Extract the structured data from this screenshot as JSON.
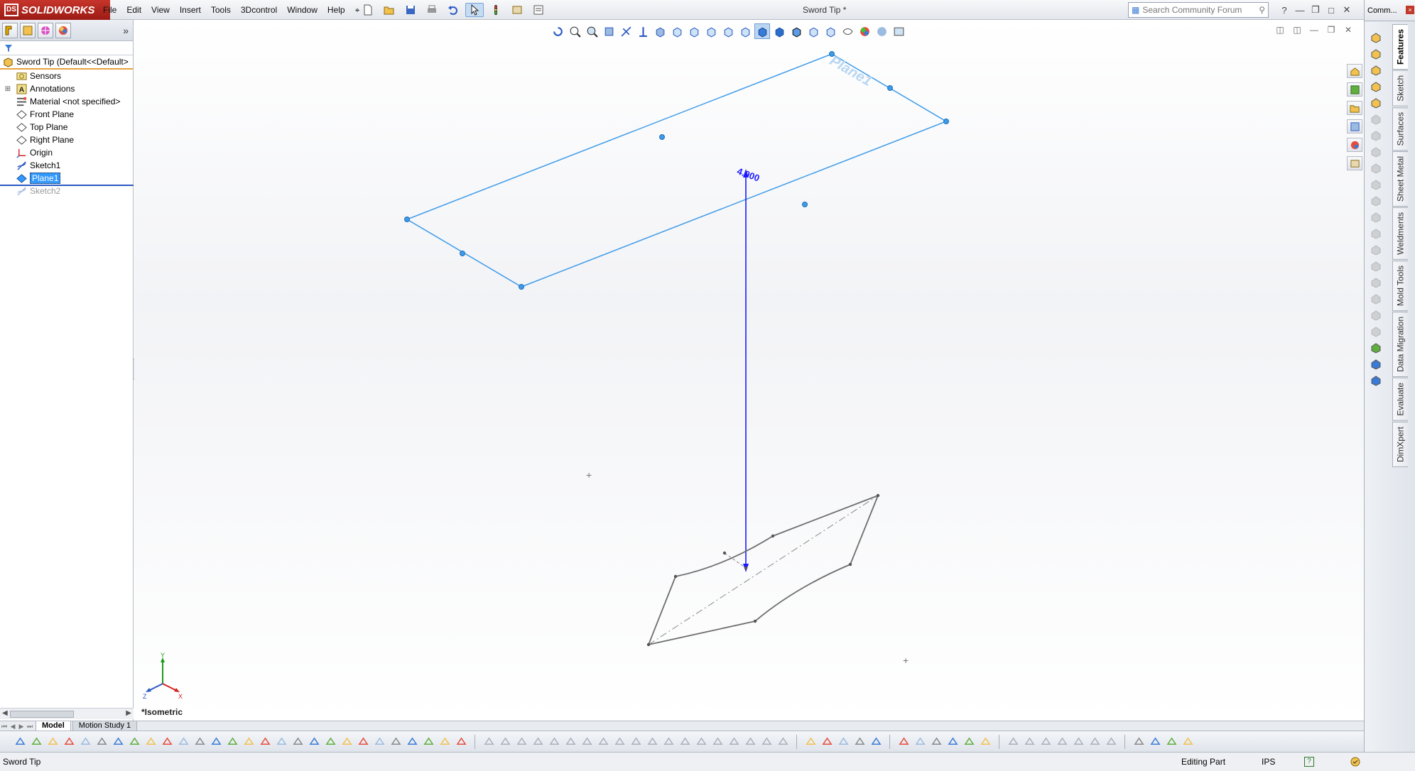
{
  "app": {
    "logo_text": "SOLIDWORKS",
    "document_title": "Sword Tip *",
    "menus": [
      "File",
      "Edit",
      "View",
      "Insert",
      "Tools",
      "3Dcontrol",
      "Window",
      "Help"
    ],
    "search_placeholder": "Search Community Forum"
  },
  "feature_tree": {
    "root": "Sword Tip  (Default<<Default>",
    "items": [
      {
        "label": "Sensors",
        "icon": "sensor-icon",
        "expandable": false
      },
      {
        "label": "Annotations",
        "icon": "annotation-icon",
        "expandable": true
      },
      {
        "label": "Material <not specified>",
        "icon": "material-icon",
        "expandable": false
      },
      {
        "label": "Front Plane",
        "icon": "plane-icon",
        "expandable": false
      },
      {
        "label": "Top Plane",
        "icon": "plane-icon",
        "expandable": false
      },
      {
        "label": "Right Plane",
        "icon": "plane-icon",
        "expandable": false
      },
      {
        "label": "Origin",
        "icon": "origin-icon",
        "expandable": false
      },
      {
        "label": "Sketch1",
        "icon": "sketch-icon",
        "expandable": false
      },
      {
        "label": "Plane1",
        "icon": "plane-icon",
        "expandable": false,
        "selected": true
      },
      {
        "label": "Sketch2",
        "icon": "sketch-icon",
        "expandable": false,
        "suppressed": true
      }
    ]
  },
  "viewport": {
    "plane_label": "Plane1",
    "dimension_value": "4.000",
    "view_name": "*Isometric",
    "triad_labels": {
      "x": "X",
      "y": "Y",
      "z": "Z"
    }
  },
  "task_pane": {
    "header": "Comm...",
    "tabs": [
      "Features",
      "Sketch",
      "Surfaces",
      "Sheet Metal",
      "Weldments",
      "Mold Tools",
      "Data Migration",
      "Evaluate",
      "DimXpert"
    ],
    "active_tab": "Features"
  },
  "bottom_tabs": {
    "model": "Model",
    "motion": "Motion Study 1"
  },
  "status_bar": {
    "document": "Sword Tip",
    "mode": "Editing Part",
    "units": "IPS"
  },
  "colors": {
    "plane_blue": "#3d9be9",
    "dimension_blue": "#1a1aff",
    "sketch_gray": "#6e6e6e",
    "selection_blue": "#3399ff",
    "logo_red": "#b5261d"
  }
}
